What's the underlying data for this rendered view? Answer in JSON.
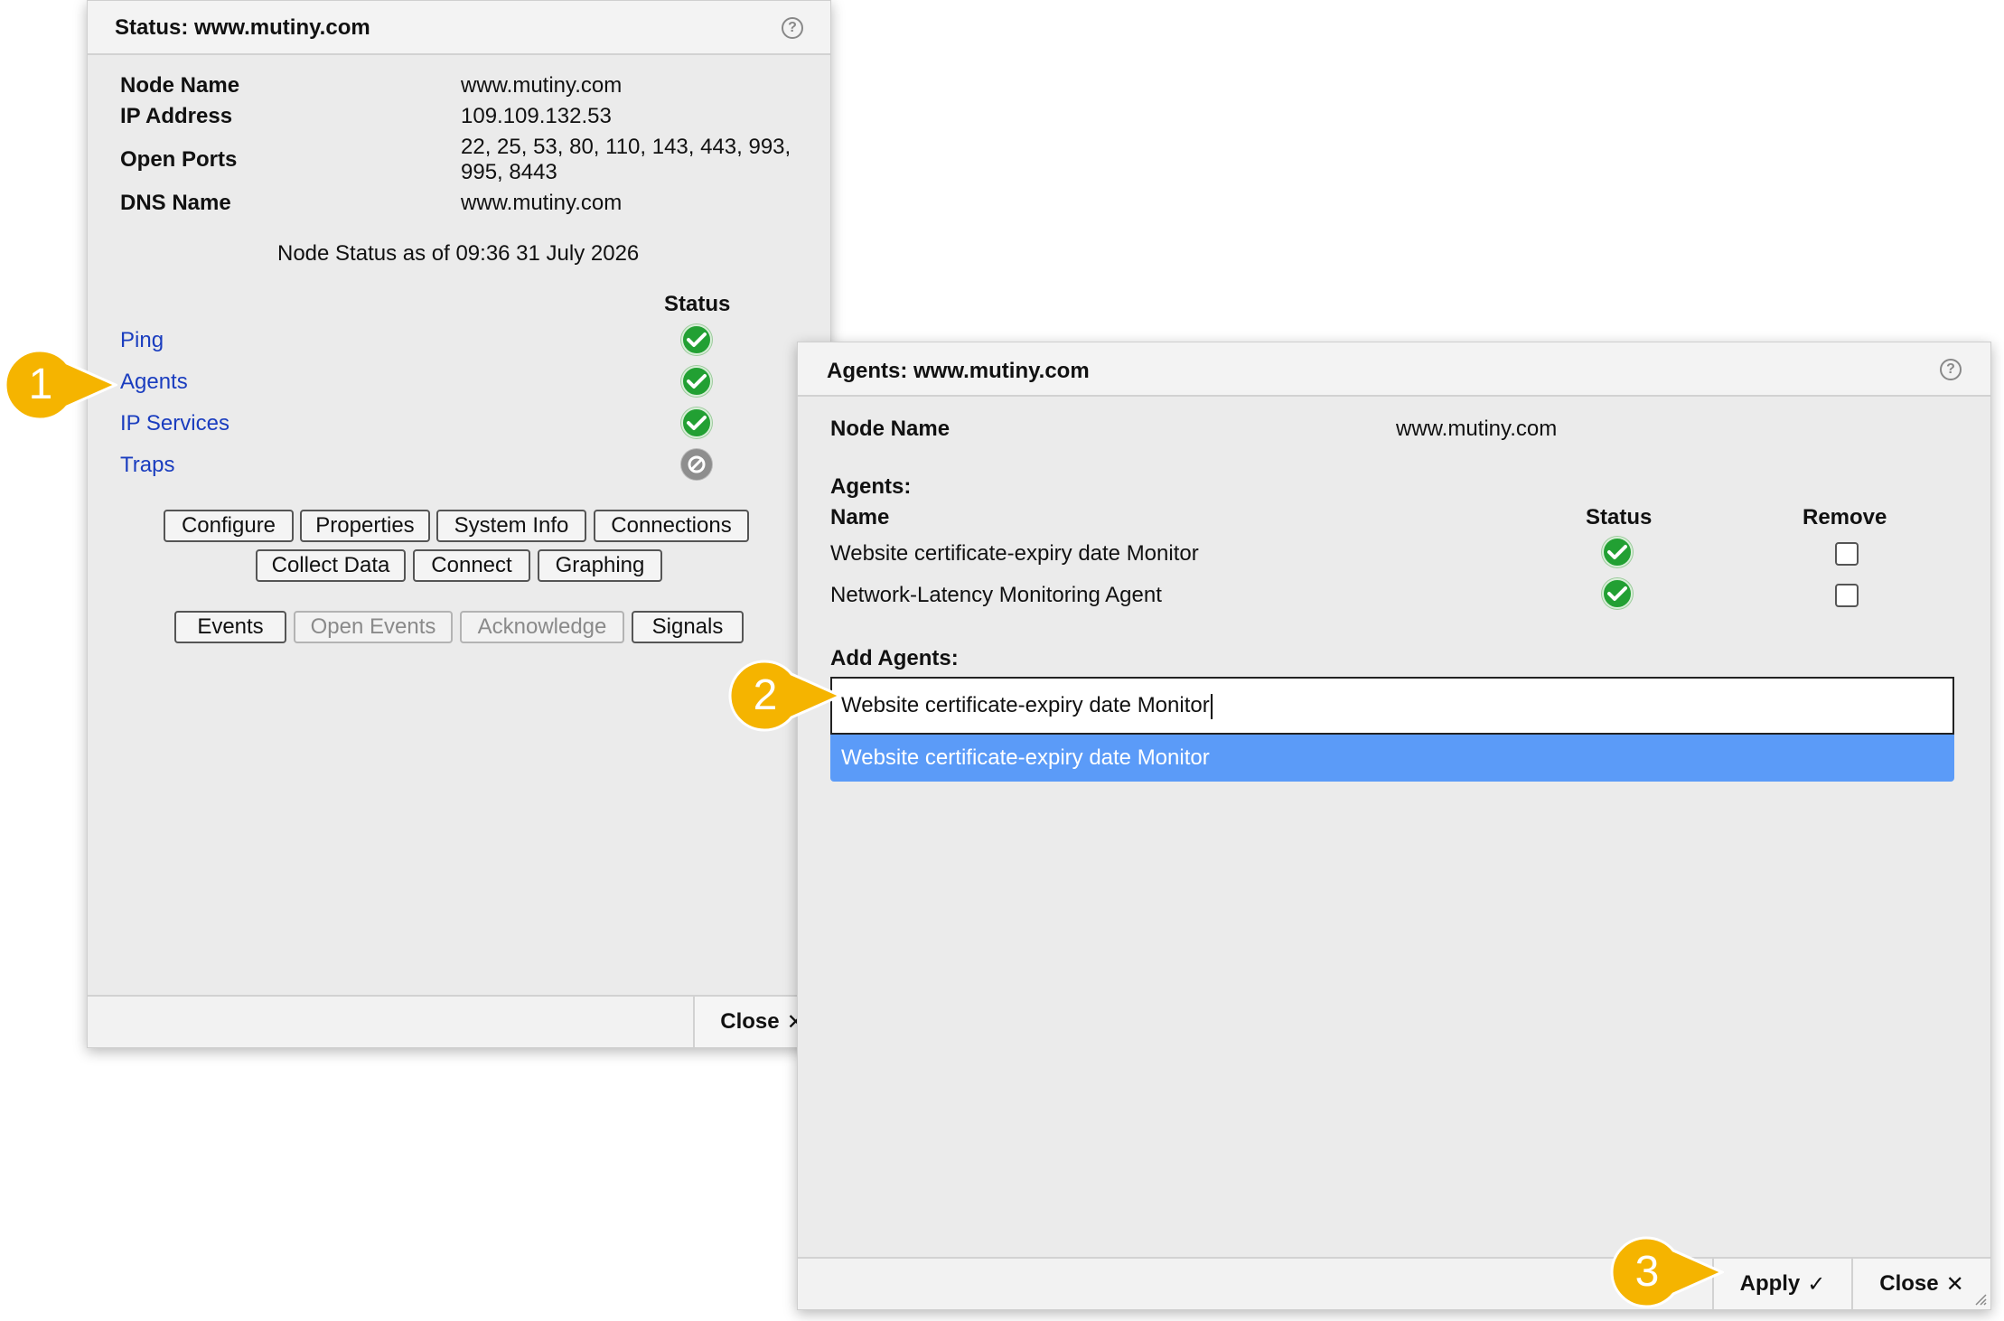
{
  "status_panel": {
    "title": "Status: www.mutiny.com",
    "fields": [
      {
        "label": "Node Name",
        "value": "www.mutiny.com"
      },
      {
        "label": "IP Address",
        "value": "109.109.132.53"
      },
      {
        "label": "Open Ports",
        "value_line1": "22, 25, 53, 80, 110, 143, 443, 993,",
        "value_line2": "995, 8443"
      },
      {
        "label": "DNS Name",
        "value": "www.mutiny.com"
      }
    ],
    "status_caption": "Node Status as of 09:36 31 July 2026",
    "status_header": "Status",
    "services": [
      {
        "name": "Ping",
        "status": "ok"
      },
      {
        "name": "Agents",
        "status": "ok"
      },
      {
        "name": "IP Services",
        "status": "ok"
      },
      {
        "name": "Traps",
        "status": "none"
      }
    ],
    "buttons_row1": [
      "Configure",
      "Properties",
      "System Info",
      "Connections"
    ],
    "buttons_row2": [
      "Collect Data",
      "Connect",
      "Graphing"
    ],
    "buttons_row3": [
      "Events",
      "Open Events",
      "Acknowledge",
      "Signals"
    ],
    "close_label": "Close"
  },
  "agents_panel": {
    "title": "Agents: www.mutiny.com",
    "node_label": "Node Name",
    "node_value": "www.mutiny.com",
    "agents_heading": "Agents:",
    "col_name": "Name",
    "col_status": "Status",
    "col_remove": "Remove",
    "agents": [
      {
        "name": "Website certificate-expiry date Monitor",
        "status": "ok",
        "remove": false
      },
      {
        "name": "Network-Latency Monitoring Agent",
        "status": "ok",
        "remove": false
      }
    ],
    "add_heading": "Add Agents:",
    "add_input_value": "Website certificate-expiry date Monitor",
    "suggestion": "Website certificate-expiry date Monitor",
    "apply_label": "Apply",
    "close_label": "Close"
  },
  "callouts": [
    "1",
    "2",
    "3"
  ],
  "colors": {
    "callout": "#f5b400",
    "link": "#1a3dbf",
    "ok_status": "#22a033",
    "suggestion_bg": "#5b9bf8"
  }
}
